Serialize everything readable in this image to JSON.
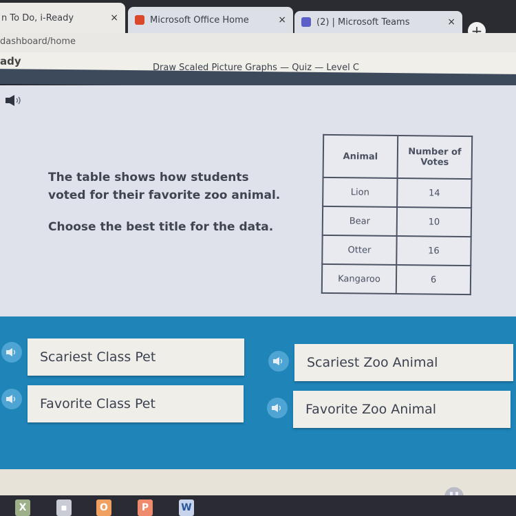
{
  "browser": {
    "tabs": [
      {
        "title": "n To Do, i-Ready",
        "active": true
      },
      {
        "title": "Microsoft Office Home",
        "active": false
      },
      {
        "title": "(2) | Microsoft Teams",
        "active": false
      }
    ],
    "close_glyph": "×",
    "new_tab_glyph": "+",
    "url": "dashboard/home"
  },
  "app": {
    "brand": "ady",
    "lesson_title": "Draw Scaled Picture Graphs — Quiz — Level C"
  },
  "question": {
    "line1": "The table shows how students",
    "line2": "voted for their favorite zoo animal.",
    "instruction": "Choose the best title for the data."
  },
  "table": {
    "headers": [
      "Animal",
      "Number of Votes"
    ],
    "rows": [
      {
        "animal": "Lion",
        "votes": "14"
      },
      {
        "animal": "Bear",
        "votes": "10"
      },
      {
        "animal": "Otter",
        "votes": "16"
      },
      {
        "animal": "Kangaroo",
        "votes": "6"
      }
    ]
  },
  "choices": [
    {
      "label": "Scariest Class Pet"
    },
    {
      "label": "Favorite Class Pet"
    },
    {
      "label": "Scariest Zoo Animal"
    },
    {
      "label": "Favorite Zoo Animal"
    }
  ],
  "taskbar": {
    "apps": [
      {
        "name": "excel",
        "glyph": "X",
        "color": "#9db08a"
      },
      {
        "name": "store",
        "glyph": "▪",
        "color": "#c9ccd4"
      },
      {
        "name": "office",
        "glyph": "O",
        "color": "#f0a060"
      },
      {
        "name": "powerpoint",
        "glyph": "P",
        "color": "#f08a6c"
      },
      {
        "name": "word",
        "glyph": "W",
        "color": "#c8d4ec"
      }
    ]
  },
  "colors": {
    "answer_area": "#1f85b9",
    "choice_bg": "#efeee9",
    "header_bar": "#3d4a5c"
  }
}
